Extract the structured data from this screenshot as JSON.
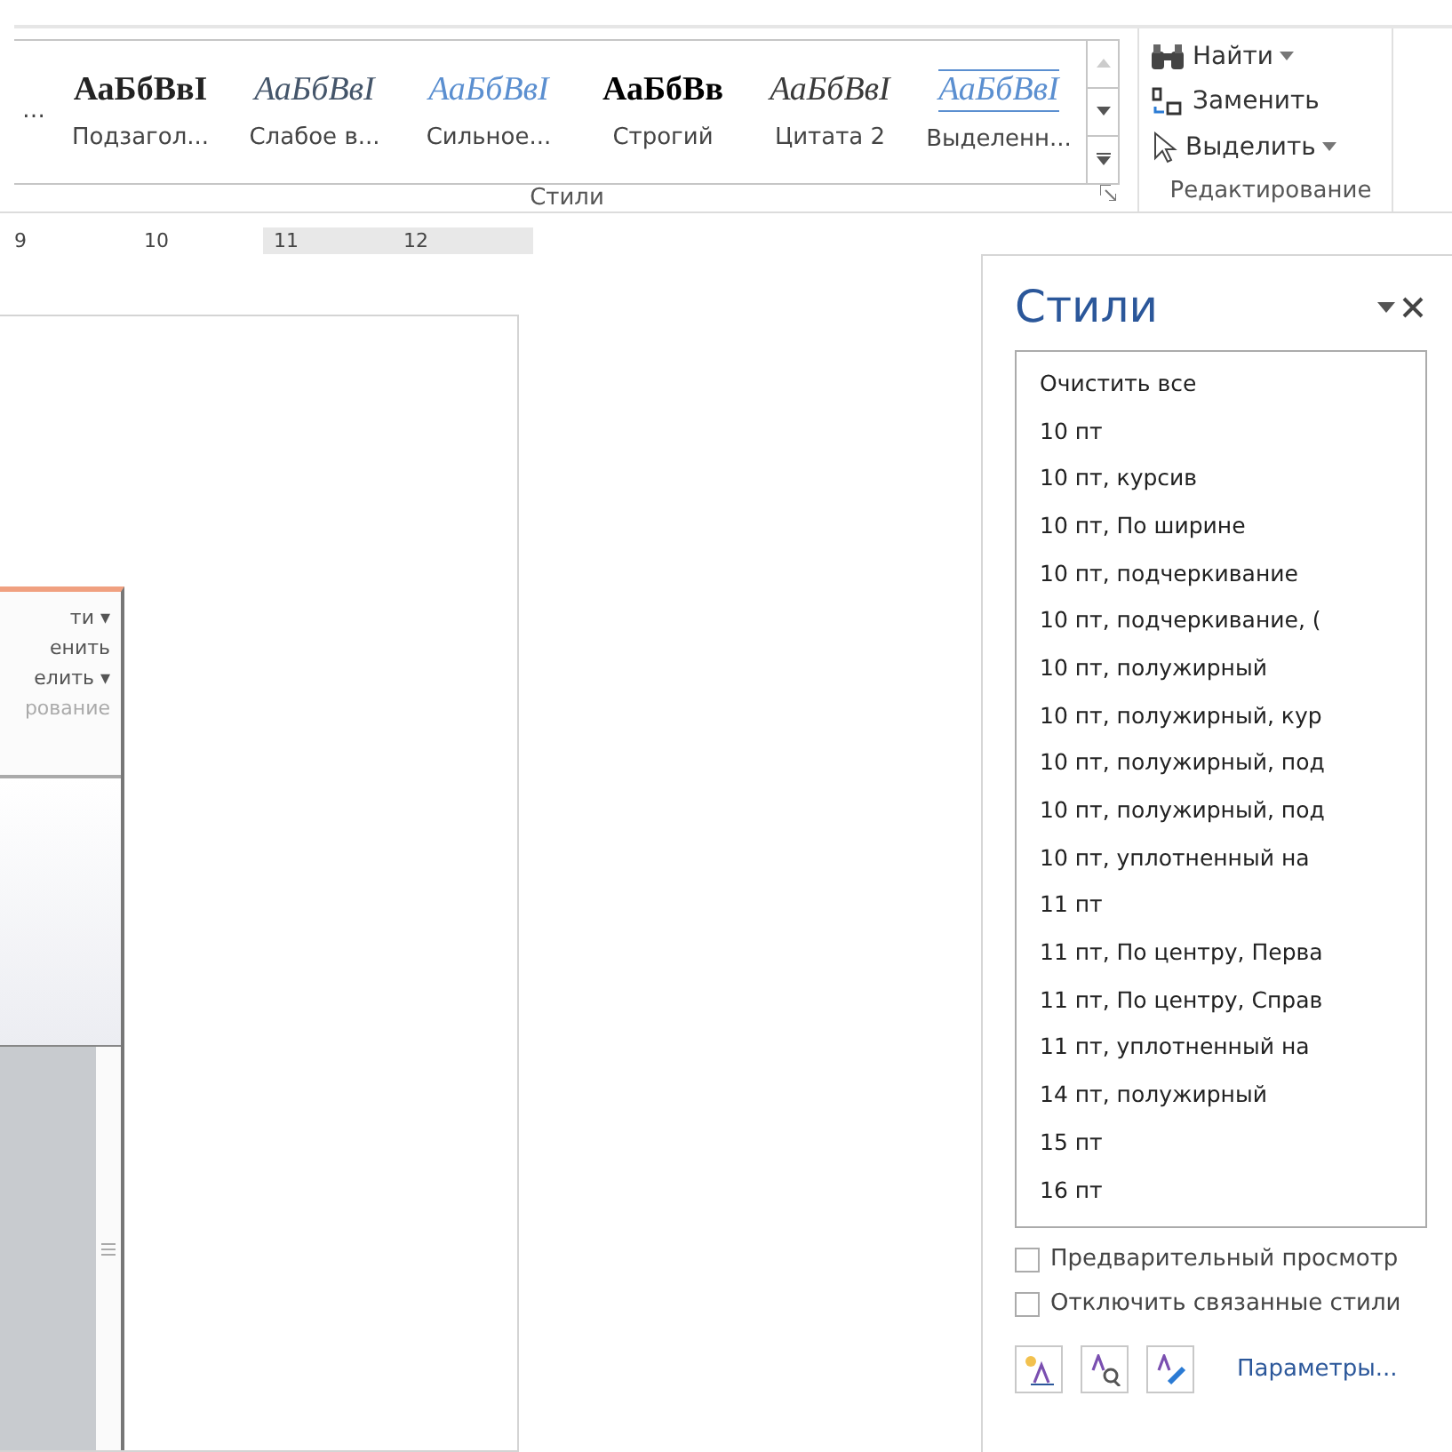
{
  "ribbon": {
    "gallery": [
      {
        "label": "…"
      },
      {
        "label": "Подзагол...",
        "sample": "АаБбВвI"
      },
      {
        "label": "Слабое в...",
        "sample": "АаБбВвI"
      },
      {
        "label": "Сильное...",
        "sample": "АаБбВвI"
      },
      {
        "label": "Строгий",
        "sample": "АаБбВв"
      },
      {
        "label": "Цитата 2",
        "sample": "АаБбВвI"
      },
      {
        "label": "Выделенн...",
        "sample": "АаБбВвI"
      }
    ],
    "styles_group": "Стили",
    "editing": [
      {
        "label": "Найти",
        "dropdown": true
      },
      {
        "label": "Заменить",
        "dropdown": false
      },
      {
        "label": "Выделить",
        "dropdown": true
      }
    ],
    "editing_group": "Редактирование"
  },
  "ruler": [
    "9",
    "10",
    "11",
    "12"
  ],
  "embedded_screenshot": {
    "lines": [
      "ти ▾",
      "енить",
      "елить ▾"
    ],
    "group": "рование"
  },
  "styles_pane": {
    "title": "Стили",
    "items": [
      "Очистить все",
      "10 пт",
      "10 пт, курсив",
      "10 пт, По ширине",
      "10 пт, подчеркивание",
      "10 пт, подчеркивание, (",
      "10 пт, полужирный",
      "10 пт, полужирный, кур",
      "10 пт, полужирный, под",
      "10 пт, полужирный, под",
      "10 пт, уплотненный на",
      "11 пт",
      "11 пт, По центру, Перва",
      "11 пт, По центру, Справ",
      "11 пт, уплотненный на",
      "14 пт, полужирный",
      "15 пт",
      "16 пт"
    ],
    "options": [
      {
        "label": "Предварительный просмотр",
        "checked": false
      },
      {
        "label": "Отключить связанные стили",
        "checked": false
      }
    ],
    "link": "Параметры..."
  }
}
